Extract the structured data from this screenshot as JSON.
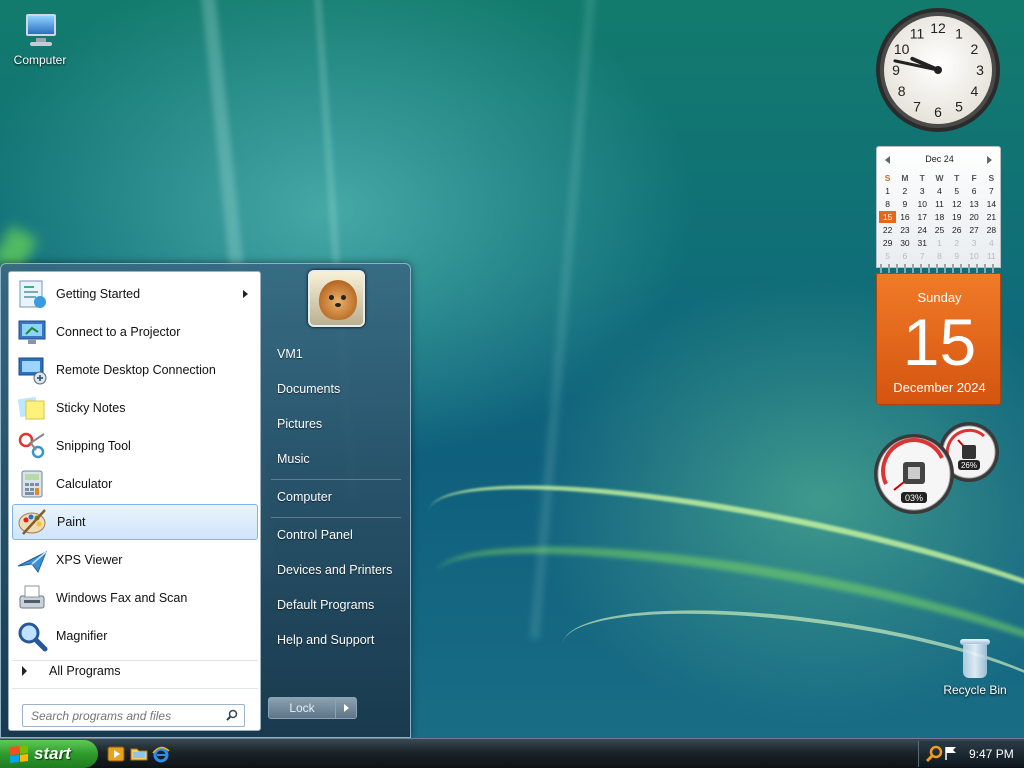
{
  "desktop": {
    "icons": [
      {
        "label": "Computer"
      },
      {
        "label": "Recycle Bin"
      }
    ]
  },
  "start_menu": {
    "programs": [
      {
        "label": "Getting Started",
        "icon": "getting-started-icon",
        "submenu": true
      },
      {
        "label": "Connect to a Projector",
        "icon": "projector-icon"
      },
      {
        "label": "Remote Desktop Connection",
        "icon": "remote-desktop-icon"
      },
      {
        "label": "Sticky Notes",
        "icon": "sticky-notes-icon"
      },
      {
        "label": "Snipping Tool",
        "icon": "scissors-icon"
      },
      {
        "label": "Calculator",
        "icon": "calculator-icon"
      },
      {
        "label": "Paint",
        "icon": "paint-palette-icon",
        "selected": true
      },
      {
        "label": "XPS Viewer",
        "icon": "xps-viewer-icon"
      },
      {
        "label": "Windows Fax and Scan",
        "icon": "fax-icon"
      },
      {
        "label": "Magnifier",
        "icon": "magnifier-icon"
      }
    ],
    "all_programs": "All Programs",
    "search_placeholder": "Search programs and files",
    "right_links": [
      {
        "label": "VM1"
      },
      {
        "label": "Documents"
      },
      {
        "label": "Pictures"
      },
      {
        "label": "Music"
      },
      {
        "label": "Computer"
      },
      {
        "label": "Control Panel"
      },
      {
        "label": "Devices and Printers"
      },
      {
        "label": "Default Programs"
      },
      {
        "label": "Help and Support"
      }
    ],
    "lock_label": "Lock"
  },
  "taskbar": {
    "start_label": "start",
    "quick_launch": [
      "media-player-icon",
      "folder-icon",
      "internet-explorer-icon"
    ],
    "time": "9:47 PM"
  },
  "gadgets": {
    "clock": {
      "hour": 9,
      "minute": 47,
      "numbers": [
        "12",
        "1",
        "2",
        "3",
        "4",
        "5",
        "6",
        "7",
        "8",
        "9",
        "10",
        "11"
      ]
    },
    "calendar": {
      "month_label": "Dec 24",
      "weekday_headers": [
        "S",
        "M",
        "T",
        "W",
        "T",
        "F",
        "S"
      ],
      "days": [
        [
          "1",
          "2",
          "3",
          "4",
          "5",
          "6",
          "7"
        ],
        [
          "8",
          "9",
          "10",
          "11",
          "12",
          "13",
          "14"
        ],
        [
          "15",
          "16",
          "17",
          "18",
          "19",
          "20",
          "21"
        ],
        [
          "22",
          "23",
          "24",
          "25",
          "26",
          "27",
          "28"
        ],
        [
          "29",
          "30",
          "31",
          "1",
          "2",
          "3",
          "4"
        ],
        [
          "5",
          "6",
          "7",
          "8",
          "9",
          "10",
          "11"
        ]
      ],
      "today": "15",
      "weekday": "Sunday",
      "month_year": "December 2024"
    },
    "meter": {
      "cpu": "03%",
      "memory": "26%",
      "cpu_value": 3,
      "memory_value": 26
    }
  },
  "colors": {
    "accent_orange": "#e8651a",
    "start_green": "#2f9a2c",
    "selection_blue": "#cfe5fa"
  }
}
